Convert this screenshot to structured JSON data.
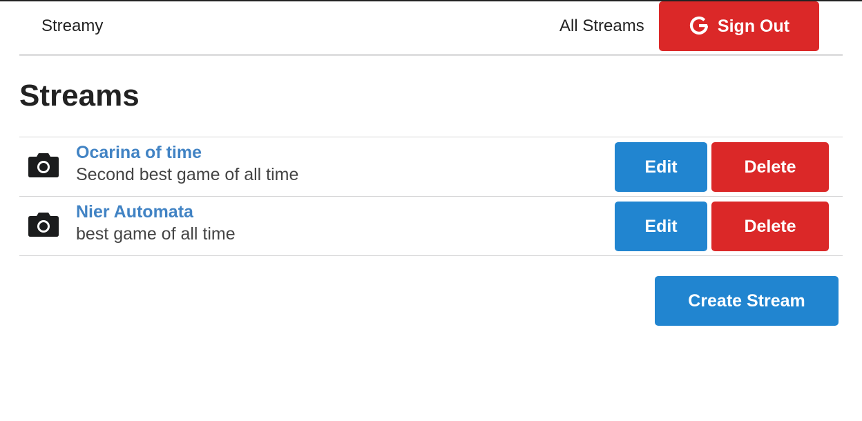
{
  "header": {
    "brand": "Streamy",
    "nav_link": "All Streams",
    "auth_button": "Sign Out",
    "auth_icon": "google-icon"
  },
  "page": {
    "title": "Streams"
  },
  "streams": [
    {
      "title": "Ocarina of time",
      "description": "Second best game of all time",
      "icon": "camera-icon",
      "edit_label": "Edit",
      "delete_label": "Delete"
    },
    {
      "title": "Nier Automata",
      "description": "best game of all time",
      "icon": "camera-icon",
      "edit_label": "Edit",
      "delete_label": "Delete"
    }
  ],
  "actions": {
    "create_label": "Create Stream"
  },
  "colors": {
    "primary_blue": "#2185d0",
    "danger_red": "#db2828",
    "link_blue": "#4183c4",
    "text_dark": "#222222"
  }
}
